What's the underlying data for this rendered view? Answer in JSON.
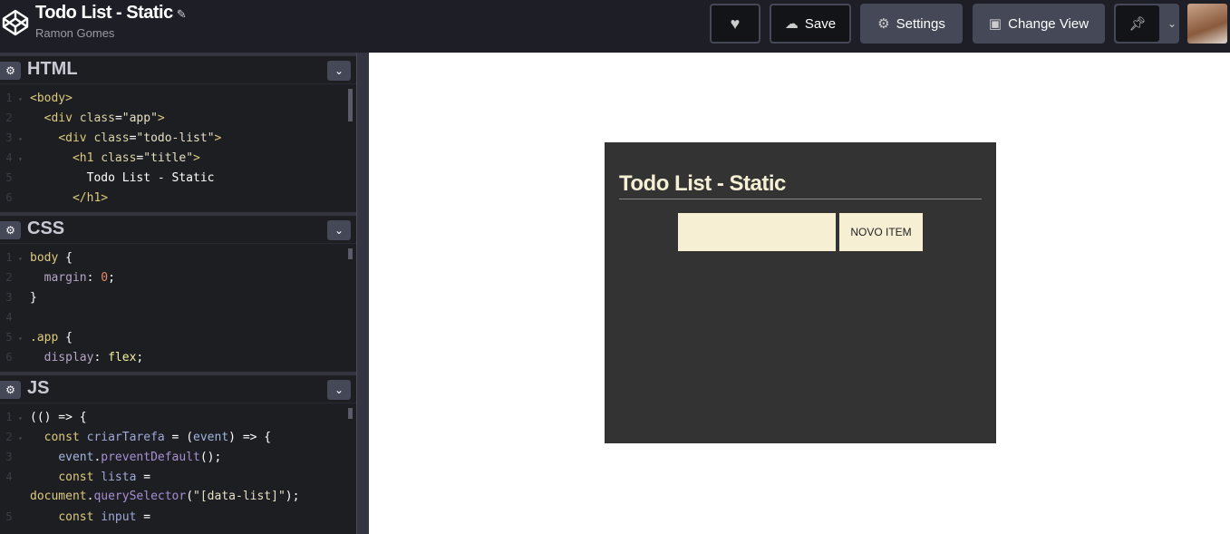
{
  "header": {
    "title": "Todo List - Static",
    "author": "Ramon Gomes",
    "buttons": {
      "love": "",
      "save": "Save",
      "settings": "Settings",
      "change_view": "Change View"
    }
  },
  "icons": {
    "logo": "codepen-logo-icon",
    "edit": "pencil-icon",
    "love": "heart-icon",
    "save": "cloud-icon",
    "settings": "gear-icon",
    "change_view": "eye-window-icon",
    "pin": "pin-icon",
    "menu": "chevron-down-icon"
  },
  "panels": [
    {
      "name": "HTML",
      "lines": [
        {
          "n": "1",
          "f": true,
          "t": [
            [
              "tag",
              "<body>"
            ]
          ]
        },
        {
          "n": "2",
          "t": [
            [
              "plain",
              "  "
            ],
            [
              "tag",
              "<div "
            ],
            [
              "attr",
              "class"
            ],
            [
              "punc",
              "="
            ],
            [
              "str",
              "\"app\""
            ],
            [
              "tag",
              ">"
            ]
          ]
        },
        {
          "n": "3",
          "f": true,
          "t": [
            [
              "plain",
              "    "
            ],
            [
              "tag",
              "<div "
            ],
            [
              "attr",
              "class"
            ],
            [
              "punc",
              "="
            ],
            [
              "str",
              "\"todo-list\""
            ],
            [
              "tag",
              ">"
            ]
          ]
        },
        {
          "n": "4",
          "f": true,
          "t": [
            [
              "plain",
              "      "
            ],
            [
              "tag",
              "<h1 "
            ],
            [
              "attr",
              "class"
            ],
            [
              "punc",
              "="
            ],
            [
              "str",
              "\"title\""
            ],
            [
              "tag",
              ">"
            ]
          ]
        },
        {
          "n": "5",
          "t": [
            [
              "txt",
              "        Todo List - Static"
            ]
          ]
        },
        {
          "n": "6",
          "t": [
            [
              "plain",
              "      "
            ],
            [
              "tag",
              "</h1>"
            ]
          ]
        }
      ]
    },
    {
      "name": "CSS",
      "lines": [
        {
          "n": "1",
          "f": true,
          "t": [
            [
              "sel",
              "body "
            ],
            [
              "punc",
              "{"
            ]
          ]
        },
        {
          "n": "2",
          "t": [
            [
              "plain",
              "  "
            ],
            [
              "prop",
              "margin"
            ],
            [
              "punc",
              ": "
            ],
            [
              "num",
              "0"
            ],
            [
              "punc",
              ";"
            ]
          ]
        },
        {
          "n": "3",
          "t": [
            [
              "punc",
              "}"
            ]
          ]
        },
        {
          "n": "4",
          "t": []
        },
        {
          "n": "5",
          "f": true,
          "t": [
            [
              "sel",
              ".app "
            ],
            [
              "punc",
              "{"
            ]
          ]
        },
        {
          "n": "6",
          "t": [
            [
              "plain",
              "  "
            ],
            [
              "prop",
              "display"
            ],
            [
              "punc",
              ": "
            ],
            [
              "val",
              "flex"
            ],
            [
              "punc",
              ";"
            ]
          ]
        }
      ]
    },
    {
      "name": "JS",
      "lines": [
        {
          "n": "1",
          "f": true,
          "t": [
            [
              "punc",
              "(() => {"
            ]
          ]
        },
        {
          "n": "2",
          "f": true,
          "t": [
            [
              "plain",
              "  "
            ],
            [
              "kw",
              "const "
            ],
            [
              "var",
              "criarTarefa"
            ],
            [
              "punc",
              " = ("
            ],
            [
              "js",
              "event"
            ],
            [
              "punc",
              ") => {"
            ]
          ]
        },
        {
          "n": "3",
          "t": [
            [
              "plain",
              "    "
            ],
            [
              "js",
              "event"
            ],
            [
              "punc",
              "."
            ],
            [
              "fn",
              "preventDefault"
            ],
            [
              "punc",
              "();"
            ]
          ]
        },
        {
          "n": "4",
          "t": [
            [
              "plain",
              "    "
            ],
            [
              "kw",
              "const "
            ],
            [
              "var",
              "lista"
            ],
            [
              "punc",
              " ="
            ]
          ]
        },
        {
          "n": "",
          "t": [
            [
              "kw",
              "document"
            ],
            [
              "punc",
              "."
            ],
            [
              "fn",
              "querySelector"
            ],
            [
              "punc",
              "("
            ],
            [
              "str",
              "\"[data-list]\""
            ],
            [
              "punc",
              ");"
            ]
          ]
        },
        {
          "n": "5",
          "t": [
            [
              "plain",
              "    "
            ],
            [
              "kw",
              "const "
            ],
            [
              "var",
              "input"
            ],
            [
              "punc",
              " ="
            ]
          ]
        }
      ]
    }
  ],
  "preview": {
    "title": "Todo List - Static",
    "input_value": "",
    "button": "NOVO ITEM"
  }
}
